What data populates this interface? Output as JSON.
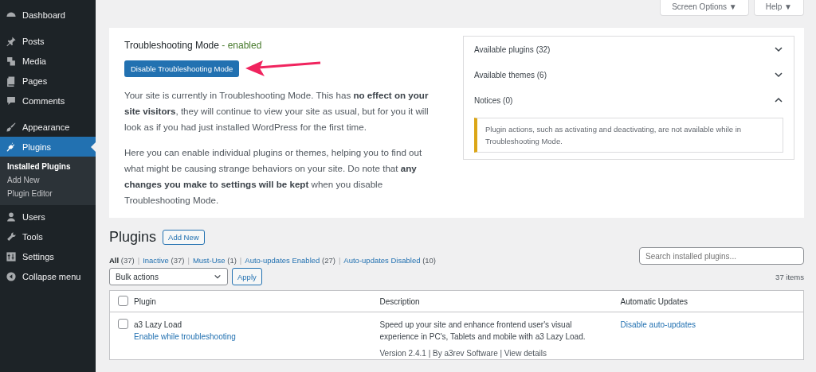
{
  "sidebar": {
    "items": [
      {
        "label": "Dashboard",
        "selected": false
      },
      {
        "label": "Posts",
        "selected": false
      },
      {
        "label": "Media",
        "selected": false
      },
      {
        "label": "Pages",
        "selected": false
      },
      {
        "label": "Comments",
        "selected": false
      },
      {
        "label": "Appearance",
        "selected": false
      },
      {
        "label": "Plugins",
        "selected": true,
        "children": [
          {
            "label": "Installed Plugins",
            "selected": true
          },
          {
            "label": "Add New",
            "selected": false
          },
          {
            "label": "Plugin Editor",
            "selected": false
          }
        ]
      },
      {
        "label": "Users",
        "selected": false
      },
      {
        "label": "Tools",
        "selected": false
      },
      {
        "label": "Settings",
        "selected": false
      },
      {
        "label": "Collapse menu",
        "selected": false
      }
    ]
  },
  "top_buttons": [
    "Screen Options ▼",
    "Help ▼"
  ],
  "troubleshooting": {
    "title": "Troubleshooting Mode",
    "status": "- enabled",
    "button": "Disable Troubleshooting Mode",
    "paragraphs": [
      "Your site is currently in Troubleshooting Mode. This has **no effect on your site visitors**, they will continue to view your site as usual, but for you it will look as if you had just installed WordPress for the first time.",
      "Here you can enable individual plugins or themes, helping you to find out what might be causing strange behaviors on your site. Do note that **any changes you make to settings will be kept** when you disable Troubleshooting Mode."
    ],
    "accordion": [
      {
        "label": "Available plugins (32)",
        "expanded": false
      },
      {
        "label": "Available themes (6)",
        "expanded": false
      },
      {
        "label": "Notices (0)",
        "expanded": true,
        "notice": "Plugin actions, such as activating and deactivating, are not available while in Troubleshooting Mode."
      }
    ]
  },
  "plugins": {
    "title": "Plugins",
    "add_new": "Add New",
    "filters": [
      {
        "label": "All",
        "count": "(37)",
        "selected": true
      },
      {
        "label": "Inactive",
        "count": "(37)",
        "selected": false
      },
      {
        "label": "Must-Use",
        "count": "(1)",
        "selected": false
      },
      {
        "label": "Auto-updates Enabled",
        "count": "(27)",
        "selected": false
      },
      {
        "label": "Auto-updates Disabled",
        "count": "(10)",
        "selected": false
      }
    ],
    "filter_separator": "|",
    "search": {
      "placeholder": "Search installed plugins..."
    },
    "bulk_actions": "Bulk actions",
    "apply": "Apply",
    "item_count": "37 items",
    "table": {
      "select_all_checked": false,
      "columns": [
        "Plugin",
        "Description",
        "Automatic Updates"
      ],
      "rows": [
        {
          "name": "a3 Lazy Load",
          "checked": false,
          "action": "Enable while troubleshooting",
          "description": "Speed up your site and enhance frontend user's visual experience in PC's, Tablets and mobile with a3 Lazy Load.",
          "meta": "Version 2.4.1 | By a3rev Software | View details",
          "auto_update": "Disable auto-updates"
        }
      ]
    }
  }
}
